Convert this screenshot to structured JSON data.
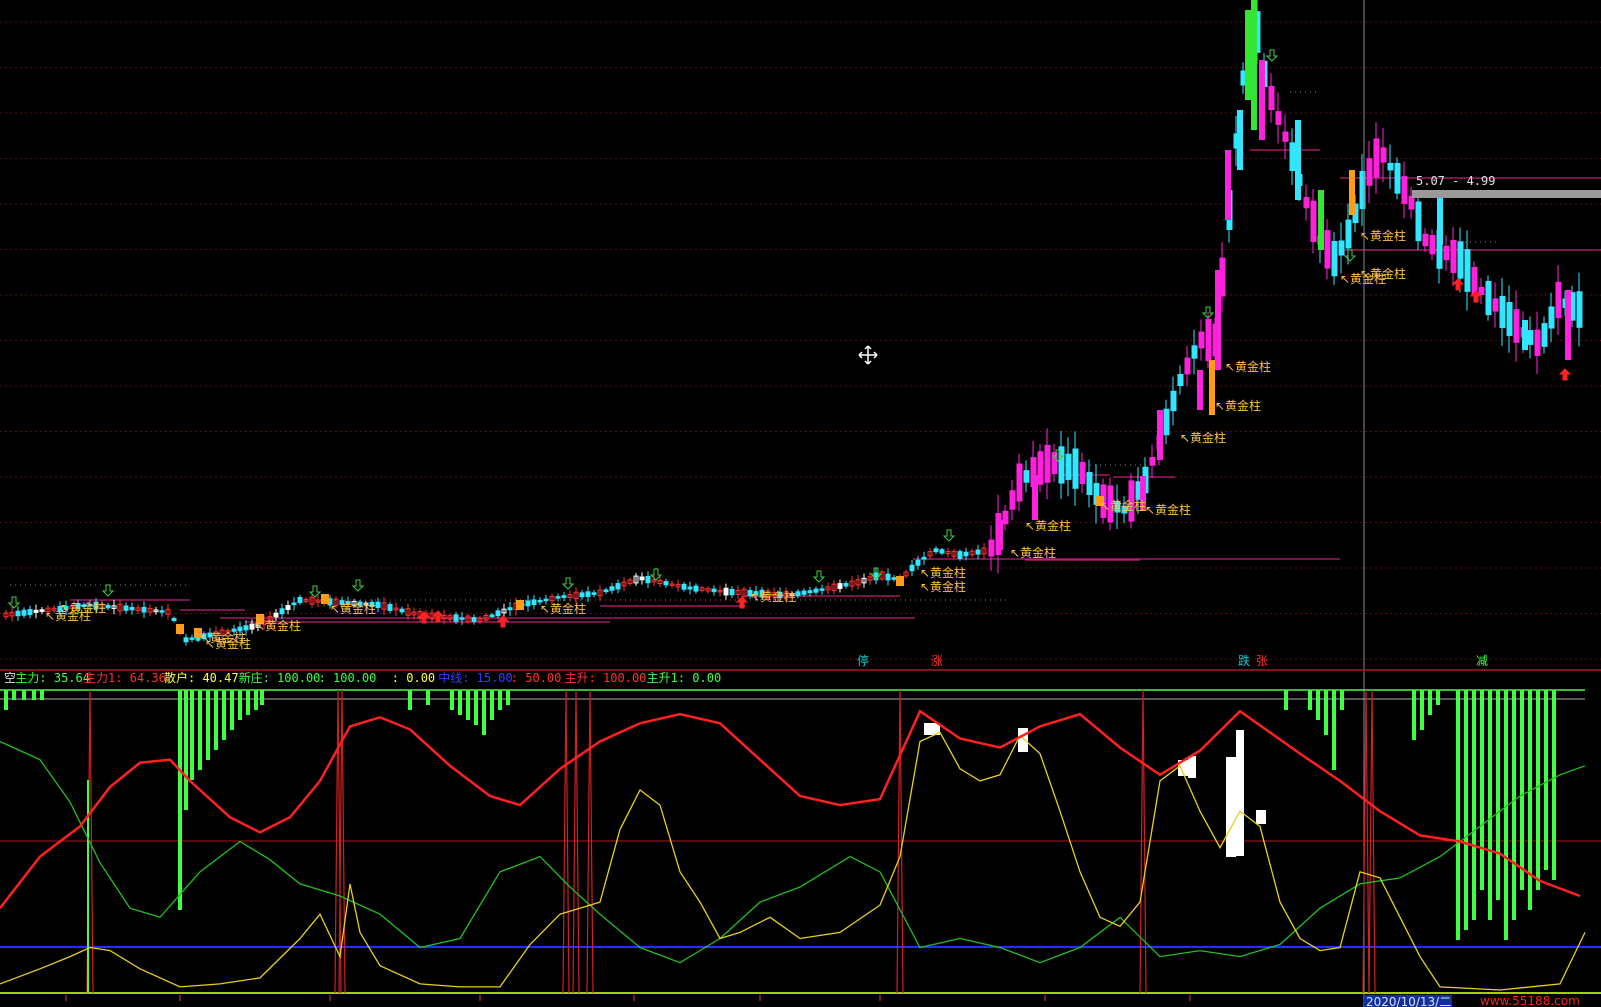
{
  "chart_data": [
    {
      "type": "candlestick",
      "name": "main-price-chart",
      "grid": true,
      "price_label": "5.07 - 4.99",
      "gold_label": "黄金柱",
      "marker_labels": [
        {
          "text": "停",
          "color": "#00d0d0"
        },
        {
          "text": "涨",
          "color": "#ff3030"
        },
        {
          "text": "跌",
          "color": "#00d0d0"
        },
        {
          "text": "张",
          "color": "#ff3030"
        },
        {
          "text": "减",
          "color": "#40ff40"
        }
      ],
      "colors": {
        "up_magenta": "#ff22dd",
        "down_cyan": "#33e6ff",
        "green_bar": "#33e633",
        "gold_bar": "#ff9c1a",
        "label_gold": "#ffc040",
        "arrow_up": "#ff2020",
        "arrow_down": "#40d040",
        "level_line": "#c0207a"
      }
    },
    {
      "type": "line",
      "name": "indicator-panel",
      "legend": [
        {
          "text": "空",
          "color": "#e0e0e0"
        },
        {
          "text": "主力: 35.64",
          "color": "#40ff40"
        },
        {
          "text": "主力1: 64.36",
          "color": "#ff3030"
        },
        {
          "text": "散户: 40.47",
          "color": "#ffff40"
        },
        {
          "text": "新庄: 100.00",
          "color": "#40ff40"
        },
        {
          "text": ": 100.00",
          "color": "#40ff40"
        },
        {
          "text": ": 0.00",
          "color": "#ffff40"
        },
        {
          "text": "中线: 15.00",
          "color": "#3040ff"
        },
        {
          "text": ": 50.00",
          "color": "#ff3030"
        },
        {
          "text": "主升: 100.00",
          "color": "#ff3030"
        },
        {
          "text": "主升1: 0.00",
          "color": "#40ff40"
        }
      ],
      "ylim": [
        0,
        100
      ],
      "reference_levels": [
        15,
        50,
        100
      ],
      "series": [
        {
          "name": "主力1",
          "color": "#ff2020"
        },
        {
          "name": "主力",
          "color": "#20c020"
        },
        {
          "name": "散户",
          "color": "#e6d020"
        },
        {
          "name": "中线",
          "color": "#2030ff"
        }
      ],
      "date_label": "2020/10/13/二"
    }
  ],
  "watermark": "www.55188.com"
}
